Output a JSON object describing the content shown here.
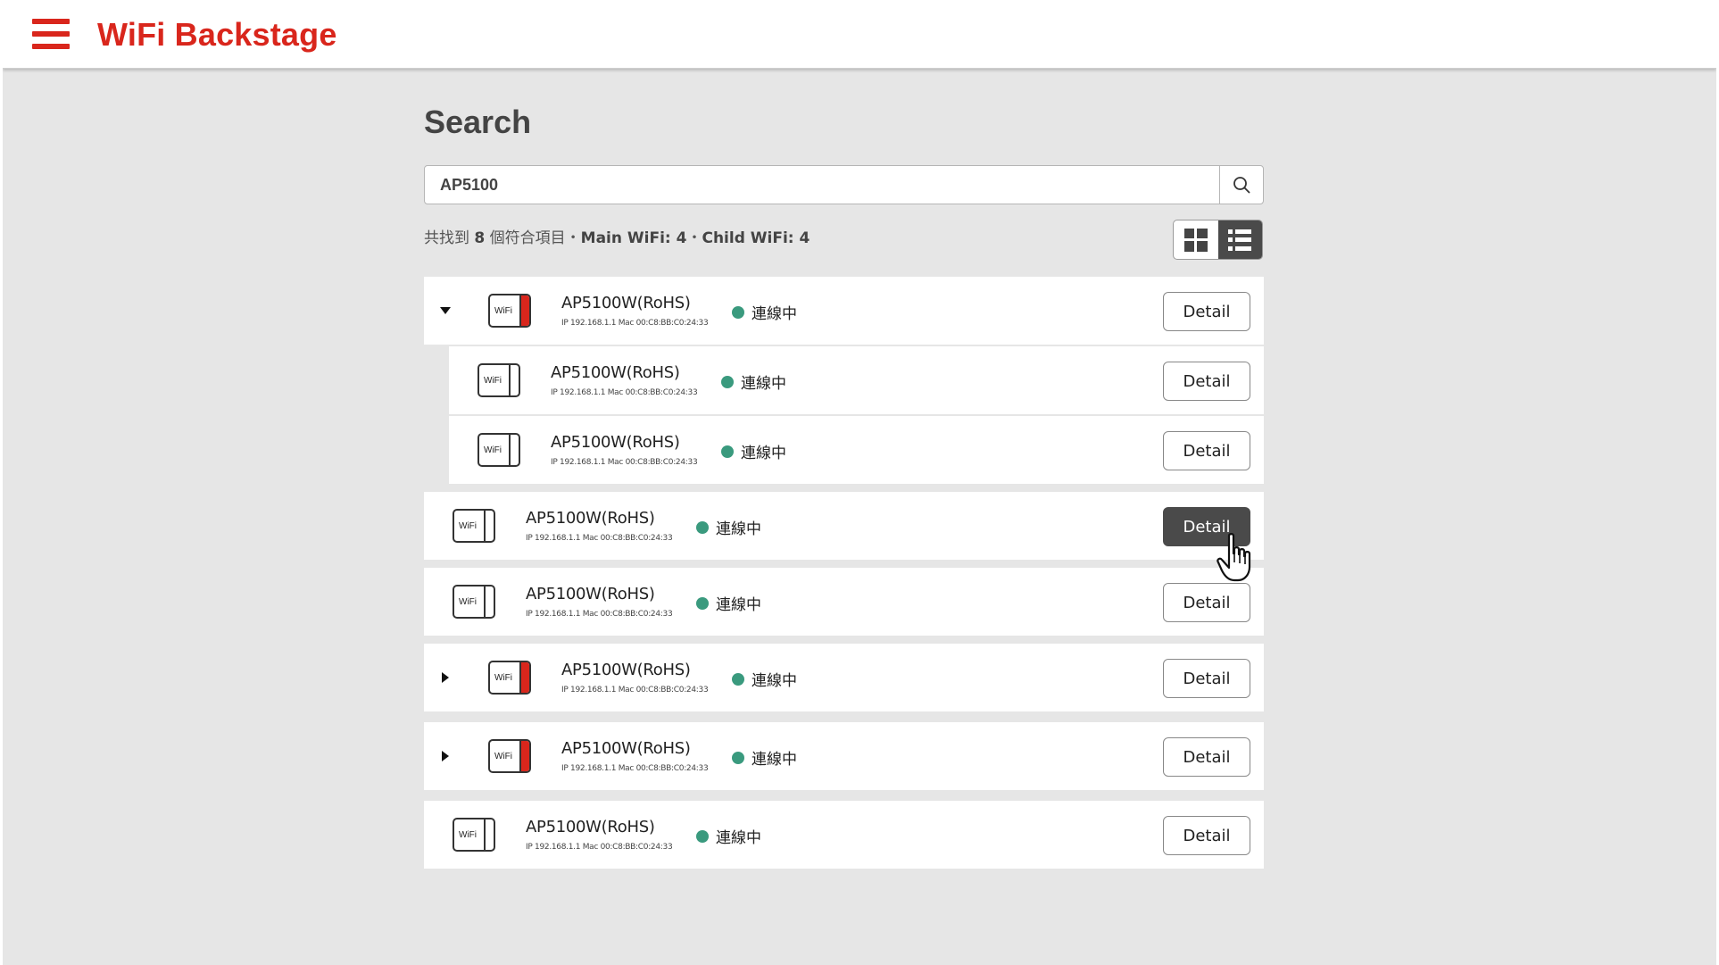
{
  "app": {
    "title": "WiFi Backstage"
  },
  "page": {
    "title": "Search"
  },
  "search": {
    "value": "AP5100"
  },
  "summary": {
    "prefix": "共找到",
    "count": "8",
    "suffix": "個符合項目・",
    "main_label": "Main WiFi: 4",
    "separator": "・",
    "child_label": "Child WiFi: 4"
  },
  "view": {
    "mode": "list"
  },
  "colors": {
    "brand": "#d9261c",
    "online": "#3a9a7e",
    "active_button": "#4a4a4a"
  },
  "devices": [
    {
      "name": "AP5100W(RoHS)",
      "meta": "IP 192.168.1.1  Mac 00:C8:BB:C0:24:33",
      "icon_label": "WiFi",
      "status": "連線中",
      "detail": "Detail",
      "type": "main",
      "expand": "expanded"
    },
    {
      "name": "AP5100W(RoHS)",
      "meta": "IP 192.168.1.1  Mac 00:C8:BB:C0:24:33",
      "icon_label": "WiFi",
      "status": "連線中",
      "detail": "Detail",
      "type": "child"
    },
    {
      "name": "AP5100W(RoHS)",
      "meta": "IP 192.168.1.1  Mac 00:C8:BB:C0:24:33",
      "icon_label": "WiFi",
      "status": "連線中",
      "detail": "Detail",
      "type": "child"
    },
    {
      "name": "AP5100W(RoHS)",
      "meta": "IP 192.168.1.1  Mac 00:C8:BB:C0:24:33",
      "icon_label": "WiFi",
      "status": "連線中",
      "detail": "Detail",
      "type": "standalone",
      "state": "hover"
    },
    {
      "name": "AP5100W(RoHS)",
      "meta": "IP 192.168.1.1  Mac 00:C8:BB:C0:24:33",
      "icon_label": "WiFi",
      "status": "連線中",
      "detail": "Detail",
      "type": "standalone"
    },
    {
      "name": "AP5100W(RoHS)",
      "meta": "IP 192.168.1.1  Mac 00:C8:BB:C0:24:33",
      "icon_label": "WiFi",
      "status": "連線中",
      "detail": "Detail",
      "type": "main",
      "expand": "collapsed"
    },
    {
      "name": "AP5100W(RoHS)",
      "meta": "IP 192.168.1.1  Mac 00:C8:BB:C0:24:33",
      "icon_label": "WiFi",
      "status": "連線中",
      "detail": "Detail",
      "type": "main",
      "expand": "collapsed"
    },
    {
      "name": "AP5100W(RoHS)",
      "meta": "IP 192.168.1.1  Mac 00:C8:BB:C0:24:33",
      "icon_label": "WiFi",
      "status": "連線中",
      "detail": "Detail",
      "type": "standalone"
    }
  ]
}
